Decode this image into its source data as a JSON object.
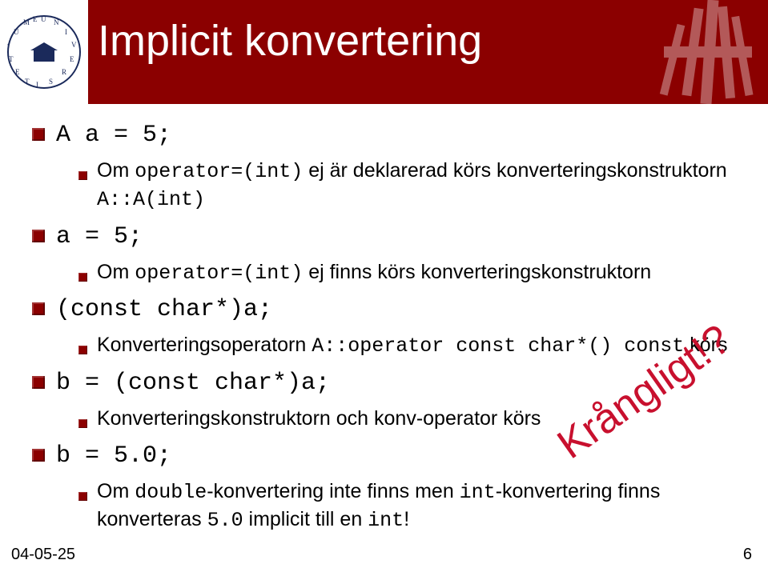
{
  "header": {
    "title": "Implicit konvertering"
  },
  "logo": {
    "institution_ring": "UMEÅ UNIVERSITET"
  },
  "bullets": {
    "b1": {
      "code": "A a = 5;"
    },
    "b1a": {
      "pre": "Om ",
      "code1": "operator=(int)",
      "mid": " ej är deklarerad körs konverteringskonstruktorn ",
      "code2": "A::A(int)"
    },
    "b2": {
      "code": "a = 5;"
    },
    "b2a": {
      "pre": "Om ",
      "code1": "operator=(int)",
      "mid": " ej finns körs konverteringskonstruktorn"
    },
    "b3": {
      "code": "(const char*)a;"
    },
    "b3a": {
      "pre": "Konverteringsoperatorn ",
      "code1": "A::operator const char*() const",
      "post": " körs"
    },
    "b4": {
      "code": "b = (const char*)a;"
    },
    "b4a": {
      "text": "Konverteringskonstruktorn och konv-operator körs"
    },
    "b5": {
      "code": "b = 5.0;"
    },
    "b5a": {
      "pre": "Om ",
      "code1": "double",
      "mid1": "-konvertering inte finns men ",
      "code2": "int",
      "mid2": "-konvertering finns konverteras ",
      "code3": "5.0",
      "mid3": " implicit till en ",
      "code4": "int",
      "post": "!"
    }
  },
  "stamp": "Krångligt!?",
  "footer": {
    "date": "04-05-25",
    "page": "6"
  }
}
